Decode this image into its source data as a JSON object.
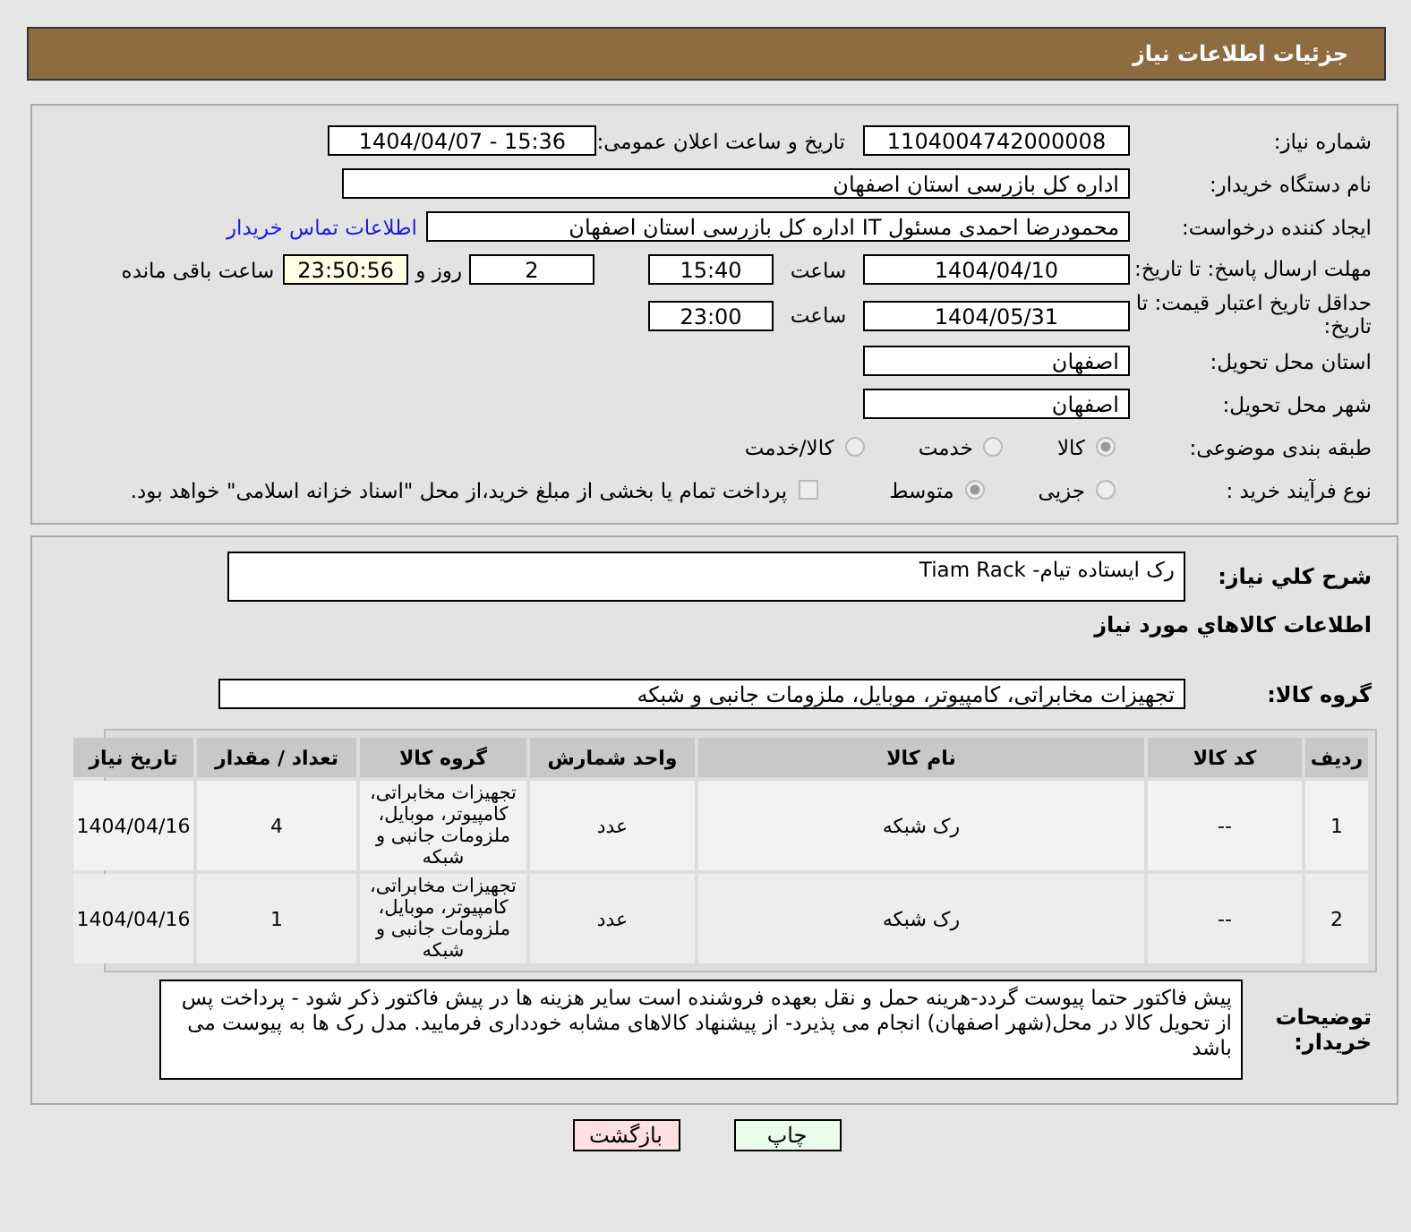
{
  "header": {
    "title": "جزئیات اطلاعات نیاز"
  },
  "need_number": {
    "label": "شماره نیاز:",
    "value": "1104004742000008"
  },
  "announce": {
    "label": "تاریخ و ساعت اعلان عمومی:",
    "value": "1404/04/07 - 15:36"
  },
  "buyer_org": {
    "label": "نام دستگاه خریدار:",
    "value": "اداره کل بازرسی استان اصفهان"
  },
  "requester": {
    "label": "ایجاد کننده درخواست:",
    "value": "محمودرضا احمدی مسئول IT اداره کل بازرسی استان اصفهان",
    "link": "اطلاعات تماس خریدار"
  },
  "reply_deadline": {
    "label": "مهلت ارسال پاسخ: تا تاریخ:",
    "date": "1404/04/10",
    "time_label": "ساعت",
    "time": "15:40",
    "days": "2",
    "days_label": "روز و",
    "remaining": "23:50:56",
    "remaining_label": "ساعت باقی مانده"
  },
  "price_validity": {
    "label": "حداقل تاریخ اعتبار قیمت: تا تاریخ:",
    "date": "1404/05/31",
    "time_label": "ساعت",
    "time": "23:00"
  },
  "province": {
    "label": "استان محل تحویل:",
    "value": "اصفهان"
  },
  "city": {
    "label": "شهر محل تحویل:",
    "value": "اصفهان"
  },
  "category": {
    "label": "طبقه بندی موضوعی:",
    "options": [
      {
        "label": "کالا",
        "selected": true
      },
      {
        "label": "خدمت",
        "selected": false
      },
      {
        "label": "کالا/خدمت",
        "selected": false
      }
    ]
  },
  "process": {
    "label": "نوع فرآیند خرید :",
    "options": [
      {
        "label": "جزیی",
        "selected": false
      },
      {
        "label": "متوسط",
        "selected": true
      }
    ],
    "payment": {
      "checked": false,
      "label": "پرداخت تمام یا بخشی از مبلغ خرید،از محل \"اسناد خزانه اسلامی\" خواهد بود."
    }
  },
  "description": {
    "label": "شرح كلي نياز:",
    "value": "رک ایستاده تیام- Tiam Rack"
  },
  "goods_title": "اطلاعات كالاهاي مورد نياز",
  "goods_group": {
    "label": "گروه کالا:",
    "value": "تجهیزات مخابراتی، کامپیوتر، موبایل، ملزومات جانبی و شبکه"
  },
  "table": {
    "columns": [
      "ردیف",
      "کد کالا",
      "نام کالا",
      "واحد شمارش",
      "گروه کالا",
      "تعداد / مقدار",
      "تاریخ نیاز"
    ],
    "rows": [
      [
        "1",
        "--",
        "رک شبکه",
        "عدد",
        "تجهیزات مخابراتی، کامپیوتر، موبایل، ملزومات جانبی و شبکه",
        "4",
        "1404/04/16"
      ],
      [
        "2",
        "--",
        "رک شبکه",
        "عدد",
        "تجهیزات مخابراتی، کامپیوتر، موبایل، ملزومات جانبی و شبکه",
        "1",
        "1404/04/16"
      ]
    ]
  },
  "buyer_notes": {
    "label": "توضیحات خریدار:",
    "value": "پیش فاکتور حتما پیوست گردد-هرینه حمل و نقل بعهده فروشنده است سایر هزینه ها در پیش فاکتور ذکر شود - پرداخت پس از تحویل کالا در محل(شهر اصفهان) انجام می پذیرد- از پیشنهاد کالاهای مشابه خودداری فرمایید. مدل رک ها به پیوست می باشد"
  },
  "buttons": [
    {
      "label": "چاپ",
      "kind": "print"
    },
    {
      "label": "بازگشت",
      "kind": "back"
    }
  ]
}
